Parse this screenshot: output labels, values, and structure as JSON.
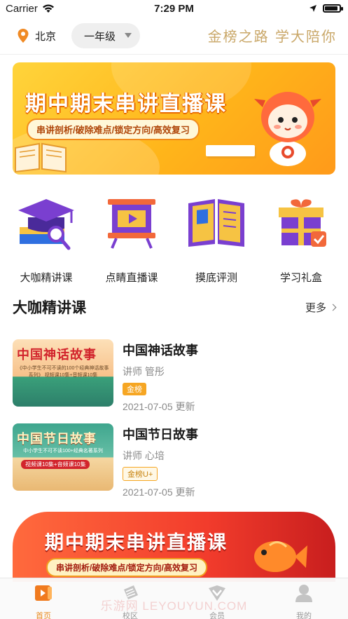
{
  "status_bar": {
    "carrier": "Carrier",
    "time": "7:29 PM"
  },
  "header": {
    "location": "北京",
    "grade_selected": "一年级",
    "slogan": "金榜之路 学大陪你"
  },
  "top_banner": {
    "title": "期中期末串讲直播课",
    "tagline": "串讲剖析/破除难点/锁定方向/高效复习"
  },
  "quick_nav": [
    {
      "label": "大咖精讲课",
      "icon": "graduation-cap-icon"
    },
    {
      "label": "点睛直播课",
      "icon": "play-screen-icon"
    },
    {
      "label": "摸底评测",
      "icon": "open-book-icon"
    },
    {
      "label": "学习礼盒",
      "icon": "gift-box-icon"
    }
  ],
  "section": {
    "title": "大咖精讲课",
    "more": "更多"
  },
  "courses": [
    {
      "thumb_title": "中国神话故事",
      "thumb_sub": "《中小学生不可不读的100个经典神话故事系列》 视频课10集+音频课10集",
      "name": "中国神话故事",
      "teacher": "讲师  管彤",
      "badge": "金榜",
      "date": "2021-07-05  更新"
    },
    {
      "thumb_title": "中国节日故事",
      "thumb_sub": "中小学生不可不读100+经典名著系列",
      "thumb_tag": "视频课10集+音频课10集",
      "name": "中国节日故事",
      "teacher": "讲师  心培",
      "badge": "金榜U+",
      "date": "2021-07-05  更新"
    }
  ],
  "bottom_banner": {
    "title": "期中期末串讲直播课",
    "tagline": "串讲剖析/破除难点/锁定方向/高效复习"
  },
  "tabbar": [
    {
      "label": "首页",
      "icon": "home-video-icon",
      "active": true
    },
    {
      "label": "校区",
      "icon": "school-icon",
      "active": false
    },
    {
      "label": "会员",
      "icon": "member-diamond-icon",
      "active": false
    },
    {
      "label": "我的",
      "icon": "profile-icon",
      "active": false
    }
  ],
  "watermark": "乐游网 LEYOUYUN.COM",
  "colors": {
    "accent": "#e98a1e",
    "gold": "#c9a768",
    "banner_orange": "#ffb51a",
    "banner_red": "#f23c2c"
  }
}
